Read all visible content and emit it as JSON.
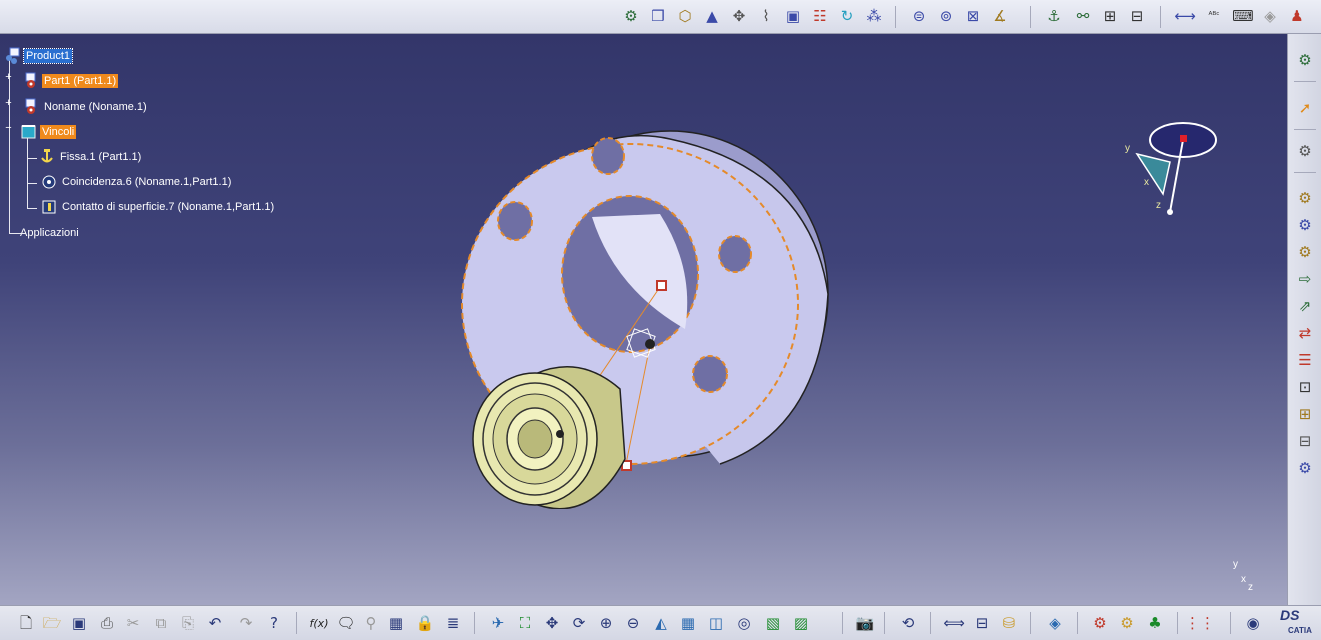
{
  "tree": {
    "root": "Product1",
    "part1": "Part1 (Part1.1)",
    "noname": "Noname (Noname.1)",
    "vincoli": "Vincoli",
    "fissa": "Fissa.1 (Part1.1)",
    "coincidenza": "Coincidenza.6 (Noname.1,Part1.1)",
    "contatto": "Contatto di superficie.7 (Noname.1,Part1.1)",
    "applicazioni": "Applicazioni"
  },
  "compass": {
    "y": "y",
    "x": "x",
    "z": "z"
  },
  "axis_indicator": {
    "y": "y",
    "x": "x",
    "z": "z"
  },
  "brand": {
    "ds": "DS",
    "catia": "CATIA"
  },
  "colors": {
    "selection_orange": "#f08a1c",
    "selection_blue": "#2a6fd0",
    "viewport_top": "#33366a",
    "viewport_bottom": "#a3a5c2"
  },
  "toolbar": {
    "top_icons": [
      "assembly-icon",
      "new-component-icon",
      "product-icon",
      "part-icon",
      "manipulate-icon",
      "snap-icon",
      "explode-icon",
      "clash-icon",
      "reuse-pattern-icon",
      "fast-multi-instantiation-icon",
      "coincidence-constraint-icon",
      "contact-constraint-icon",
      "offset-constraint-icon",
      "angle-constraint-icon",
      "fix-icon",
      "fix-together-icon",
      "quick-constraint-icon",
      "change-constraint-icon",
      "measure-icon",
      "annotation-icon",
      "text-icon",
      "sectioning-icon",
      "scene-icon"
    ],
    "right_icons": [
      "properties-icon",
      "select-icon",
      "catalog-icon",
      "insert-new-component-icon",
      "insert-new-product-icon",
      "insert-new-part-icon",
      "existing-component-icon",
      "existing-with-positioning-icon",
      "replace-component-icon",
      "graph-tree-reordering-icon",
      "generate-numbering-icon",
      "selective-load-icon",
      "manage-representations-icon",
      "multi-instantiation-icon"
    ],
    "bottom_icons": [
      "new-icon",
      "open-icon",
      "save-icon",
      "print-icon",
      "cut-icon",
      "copy-icon",
      "paste-icon",
      "undo-icon",
      "redo-icon",
      "whats-this-icon",
      "formula-icon",
      "comment-icon",
      "knowledge-icon",
      "table-icon",
      "lock-icon",
      "design-table-icon",
      "fly-mode-icon",
      "fit-all-icon",
      "pan-icon",
      "rotate-icon",
      "zoom-in-icon",
      "zoom-out-icon",
      "normal-view-icon",
      "iso-view-icon",
      "quick-view-icon",
      "hide-show-icon",
      "render-style-icon",
      "material-icon",
      "capture-icon",
      "update-icon",
      "measure-between-icon",
      "measure-item-icon",
      "measure-inertia-icon",
      "catalog-browser-icon",
      "apply-material-icon",
      "reorder-icon",
      "multiview-icon",
      "grid-icon",
      "swap-icon"
    ]
  }
}
